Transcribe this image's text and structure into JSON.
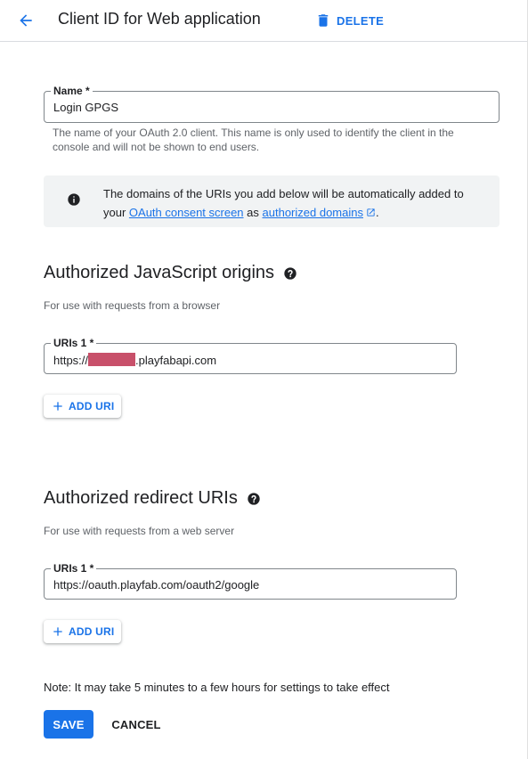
{
  "header": {
    "title": "Client ID for Web application",
    "delete_label": "DELETE",
    "accent_color": "#1a73e8"
  },
  "name_field": {
    "label": "Name *",
    "value": "Login GPGS",
    "hint": "The name of your OAuth 2.0 client. This name is only used to identify the client in the console and will not be shown to end users."
  },
  "info_banner": {
    "text_before": "The domains of the URIs you add below will be automatically added to your ",
    "link1": "OAuth consent screen",
    "text_middle": " as ",
    "link2": "authorized domains",
    "text_end": "."
  },
  "js_origins": {
    "title": "Authorized JavaScript origins",
    "hint": "For use with requests from a browser",
    "uri_label": "URIs 1 *",
    "uri_prefix": "https://",
    "uri_suffix": ".playfabapi.com",
    "add_label": "ADD URI"
  },
  "redirect_uris": {
    "title": "Authorized redirect URIs",
    "hint": "For use with requests from a web server",
    "uri_label": "URIs 1 *",
    "uri_value": "https://oauth.playfab.com/oauth2/google",
    "add_label": "ADD URI"
  },
  "footer": {
    "note": "Note: It may take 5 minutes to a few hours for settings to take effect",
    "save_label": "SAVE",
    "cancel_label": "CANCEL"
  }
}
